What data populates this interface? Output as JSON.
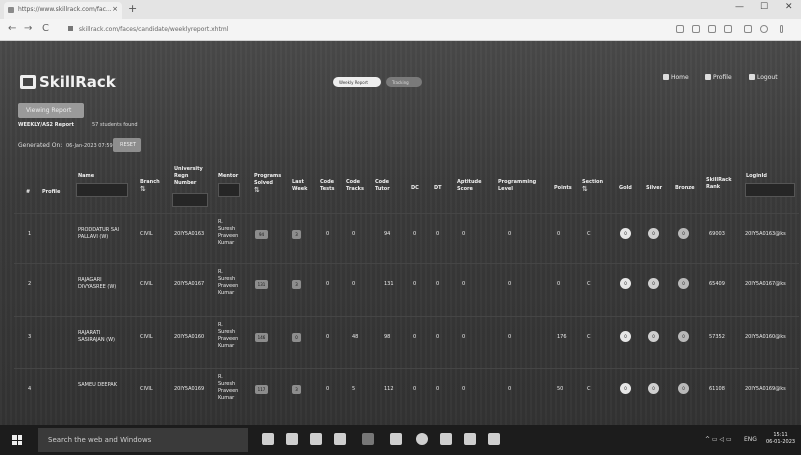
{
  "browser": {
    "tab_title": "https://www.skillrack.com/fac...",
    "url": "skillrack.com/faces/candidate/weeklyreport.xhtml",
    "nav_back": "←",
    "nav_forward": "→",
    "nav_reload": "C",
    "new_tab": "+",
    "tab_close": "×",
    "win_min": "—",
    "win_max": "☐",
    "win_close": "✕"
  },
  "header": {
    "logo": "SkillRack",
    "toggle_on": "Weekly Report",
    "toggle_off": "Tracking",
    "nav": [
      {
        "label": "Home",
        "icon": "home-icon"
      },
      {
        "label": "Profile",
        "icon": "profile-icon"
      },
      {
        "label": "Logout",
        "icon": "logout-icon"
      }
    ]
  },
  "report": {
    "viewing_button": "Viewing Report",
    "report_name": "WEEKLY/AS2 Report",
    "students_found": "57 students found",
    "generated_label": "Generated On:",
    "generated_date": "06-Jan-2023 07:59",
    "reset_button": "RESET"
  },
  "table": {
    "columns": [
      {
        "label": "#"
      },
      {
        "label": "Profile"
      },
      {
        "label": "Name"
      },
      {
        "label": "Branch",
        "sort": "⇅"
      },
      {
        "label": "University Regn Number"
      },
      {
        "label": "Mentor"
      },
      {
        "label": "Programs Solved",
        "sort": "⇅"
      },
      {
        "label": "Last Week"
      },
      {
        "label": "Code Tests"
      },
      {
        "label": "Code Tracks"
      },
      {
        "label": "Code Tutor"
      },
      {
        "label": "DC"
      },
      {
        "label": "DT"
      },
      {
        "label": "Aptitude Score"
      },
      {
        "label": "Programming Level"
      },
      {
        "label": "Points"
      },
      {
        "label": "Section",
        "sort": "⇅"
      },
      {
        "label": "Gold"
      },
      {
        "label": "Silver"
      },
      {
        "label": "Bronze"
      },
      {
        "label": "SkillRack Rank"
      },
      {
        "label": "LoginId"
      }
    ],
    "rows": [
      {
        "num": "1",
        "name": [
          "PRODDATUR SAI",
          "PALLAVI (W)"
        ],
        "branch": "CIVIL",
        "regn": "20IY5A0163",
        "mentor": [
          "R.",
          "Suresh",
          "Praveen",
          "Kumar"
        ],
        "solved": "94",
        "last_week": "3",
        "code_tests": "0",
        "code_tracks": "0",
        "code_tutor": "94",
        "dc": "0",
        "dt": "0",
        "aptitude": "0",
        "prog_level": "0",
        "points": "0",
        "section": "C",
        "gold": "0",
        "silver": "0",
        "bronze": "0",
        "rank": "69003",
        "login": "20IY5A0163@ks"
      },
      {
        "num": "2",
        "name": [
          "RAJAGARI",
          "DIVYASREE (W)"
        ],
        "branch": "CIVIL",
        "regn": "20IY5A0167",
        "mentor": [
          "R.",
          "Suresh",
          "Praveen",
          "Kumar"
        ],
        "solved": "131",
        "last_week": "3",
        "code_tests": "0",
        "code_tracks": "0",
        "code_tutor": "131",
        "dc": "0",
        "dt": "0",
        "aptitude": "0",
        "prog_level": "0",
        "points": "0",
        "section": "C",
        "gold": "0",
        "silver": "0",
        "bronze": "0",
        "rank": "65409",
        "login": "20IY5A0167@ks"
      },
      {
        "num": "3",
        "name": [
          "RAJARATI",
          "SASIRAJAN (W)"
        ],
        "branch": "CIVIL",
        "regn": "20IY5A0160",
        "mentor": [
          "R.",
          "Suresh",
          "Praveen",
          "Kumar"
        ],
        "solved": "146",
        "last_week": "0",
        "code_tests": "0",
        "code_tracks": "48",
        "code_tutor": "98",
        "dc": "0",
        "dt": "0",
        "aptitude": "0",
        "prog_level": "0",
        "points": "176",
        "section": "C",
        "gold": "0",
        "silver": "0",
        "bronze": "0",
        "rank": "57352",
        "login": "20IY5A0160@ks"
      },
      {
        "num": "4",
        "name": [
          "SAMEU DEEPAK",
          ""
        ],
        "branch": "CIVIL",
        "regn": "20IY5A0169",
        "mentor": [
          "R.",
          "Suresh",
          "Praveen",
          "Kumar"
        ],
        "solved": "117",
        "last_week": "3",
        "code_tests": "0",
        "code_tracks": "5",
        "code_tutor": "112",
        "dc": "0",
        "dt": "0",
        "aptitude": "0",
        "prog_level": "0",
        "points": "50",
        "section": "C",
        "gold": "0",
        "silver": "0",
        "bronze": "0",
        "rank": "61108",
        "login": "20IY5A0169@ks"
      }
    ]
  },
  "taskbar": {
    "search_placeholder": "Search the web and Windows",
    "tray_text": "ENG",
    "time": "15:11",
    "date": "06-01-2023"
  }
}
